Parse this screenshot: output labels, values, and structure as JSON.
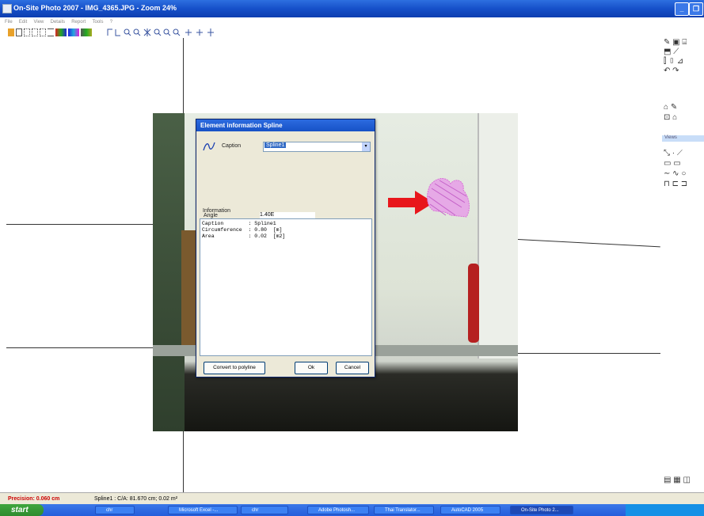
{
  "window": {
    "title": "On-Site Photo 2007 - IMG_4365.JPG - Zoom 24%"
  },
  "menubar": {
    "items": [
      "File",
      "Edit",
      "View",
      "Details",
      "Report",
      "Tools",
      "?"
    ]
  },
  "dialog": {
    "title": "Element information Spline",
    "caption_label": "Caption",
    "caption_value": "Spline1",
    "angle_label": "Angle",
    "angle_value": "1.40E",
    "information_label": "Information",
    "info_lines": [
      "Caption        : Spline1",
      "Circumference  : 0.80  [m]",
      "Area           : 0.02  [m2]"
    ],
    "convert_button": "Convert to polyline",
    "ok_button": "Ok",
    "cancel_button": "Cancel"
  },
  "right_panel": {
    "views_label": "Views"
  },
  "status": {
    "precision": "Precision: 0.060 cm",
    "selection": "Spline1 : C/A: 81.670 cm; 0.02 m²"
  },
  "taskbar": {
    "start": "start",
    "tasks": [
      "chr",
      "Microsoft Excel -...",
      "chr",
      "Adobe Photosh...",
      "Thai Translator...",
      "AutoCAD 2005",
      "On-Site Photo 2..."
    ]
  },
  "colors": {
    "arrow": "#e8161b",
    "spline": "#d86fd6",
    "titlebar": "#1650c9"
  }
}
